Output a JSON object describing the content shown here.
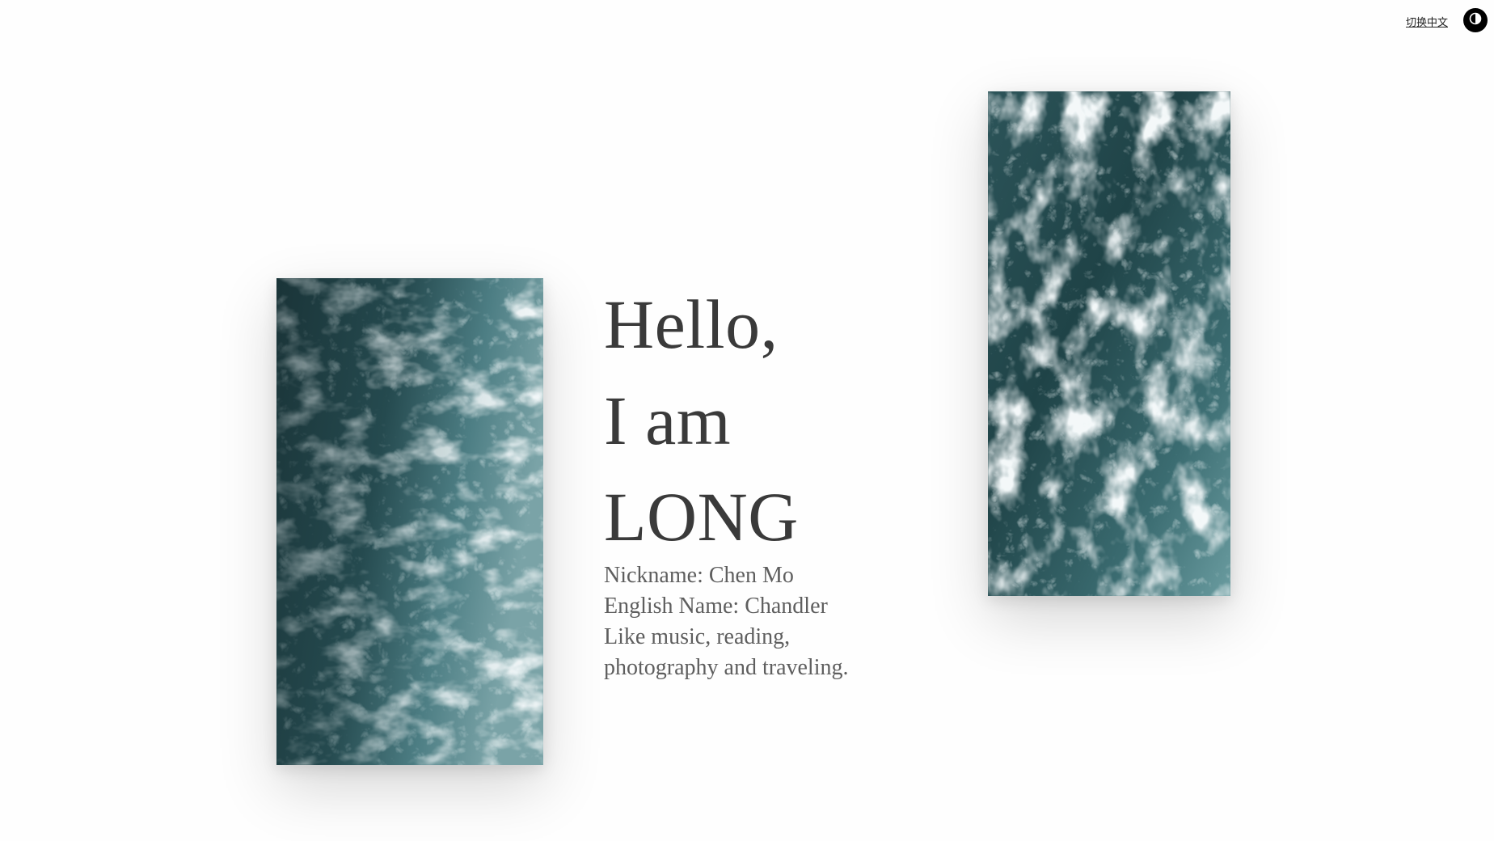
{
  "header": {
    "lang_switch_label": "切换中文",
    "theme_toggle_icon": "contrast-icon"
  },
  "hero": {
    "greeting": [
      "Hello,",
      "I am",
      "LONG"
    ],
    "details": [
      "Nickname: Chen Mo",
      "English Name: Chandler",
      "Like music, reading,",
      "photography and traveling."
    ]
  },
  "images": {
    "left": {
      "subject": "ocean-waves"
    },
    "right": {
      "subject": "ocean-waves"
    }
  },
  "colors": {
    "background": "#fefefe",
    "heading": "#3a3a3a",
    "body_text": "#5e5e5e",
    "water_dark": "#1d3a3f",
    "water_mid": "#3f6f74",
    "foam": "#dfe9ea"
  }
}
